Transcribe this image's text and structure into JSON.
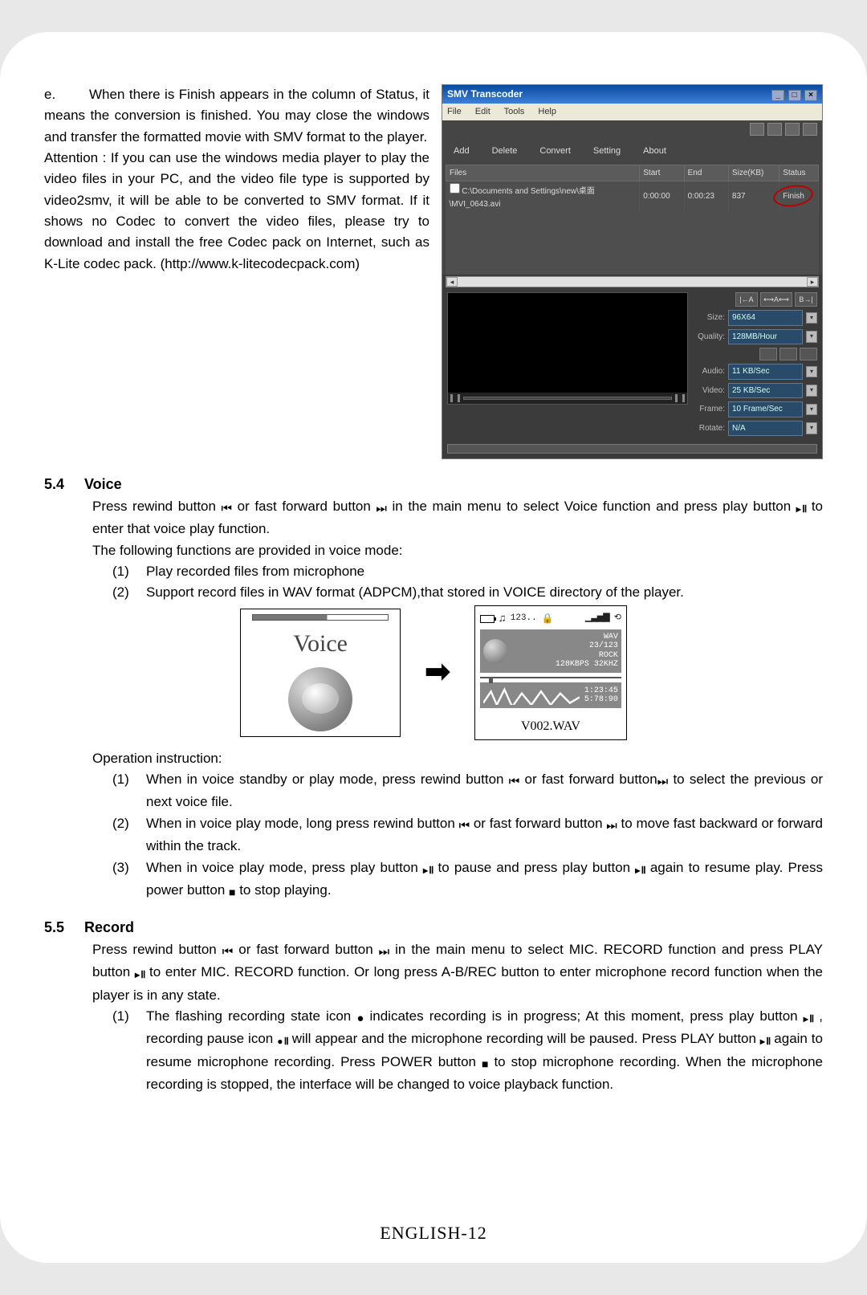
{
  "page_number": "ENGLISH-12",
  "intro": {
    "e_letter": "e.",
    "e_text": "When there is Finish appears in the column of Status, it means the conversion is finished. You may close the windows and transfer the formatted movie with SMV format to the player.",
    "attention": "Attention : If you can use the windows media player to play the video files in your PC, and the video file type is supported by video2smv, it will be able to be converted to SMV format. If it shows no Codec to convert the video files, please try to download and install the free Codec pack on Internet, such as K-Lite codec pack. (http://www.k-litecodecpack.com)"
  },
  "transcoder": {
    "title": "SMV Transcoder",
    "menu": {
      "file": "File",
      "edit": "Edit",
      "tools": "Tools",
      "help": "Help"
    },
    "toolbar": {
      "add": "Add",
      "delete": "Delete",
      "convert": "Convert",
      "setting": "Setting",
      "about": "About"
    },
    "columns": {
      "files": "Files",
      "start": "Start",
      "end": "End",
      "size": "Size(KB)",
      "status": "Status"
    },
    "row": {
      "path": "C:\\Documents and Settings\\new\\桌面\\MVI_0643.avi",
      "start": "0:00:00",
      "end": "0:00:23",
      "size": "837",
      "status": "Finish"
    },
    "settings": {
      "size_label": "Size:",
      "size_value": "96X64",
      "quality_label": "Quality:",
      "quality_value": "128MB/Hour",
      "audio_label": "Audio:",
      "audio_value": "11 KB/Sec",
      "video_label": "Video:",
      "video_value": "25 KB/Sec",
      "frame_label": "Frame:",
      "frame_value": "10 Frame/Sec",
      "rotate_label": "Rotate:",
      "rotate_value": "N/A",
      "trim_a": "|←A",
      "trim_b": "B→|",
      "trim_x": "⟷A⟷"
    }
  },
  "sec54": {
    "num": "5.4",
    "title": "Voice",
    "p1a": "Press rewind button ",
    "p1b": " or fast forward button ",
    "p1c": " in the main menu to select Voice function and press play button  ",
    "p1d": "  to enter that voice play function.",
    "p2": "The following functions are provided in voice mode:",
    "item1_n": "(1)",
    "item1": "Play recorded files from microphone",
    "item2_n": "(2)",
    "item2": "Support record files in WAV format (ADPCM),that stored in VOICE directory of the player.",
    "fig": {
      "voice_label": "Voice",
      "wav": "WAV",
      "track_no": "23/123",
      "codec": "ROCK",
      "bitrate": "128KBPS  32KHZ",
      "elapsed": "1:23:45",
      "total": "5:78:90",
      "filename": "V002.WAV"
    },
    "opinst": "Operation instruction:",
    "op1_n": "(1)",
    "op1a": "When in voice standby or play mode, press rewind button ",
    "op1b": " or fast forward button",
    "op1c": " to select the previous or next voice file.",
    "op2_n": "(2)",
    "op2a": "When in voice play mode, long press rewind button ",
    "op2b": " or fast forward button ",
    "op2c": " to move fast backward or forward within the track.",
    "op3_n": "(3)",
    "op3a": "When in voice play mode, press play button  ",
    "op3b": "  to pause and press play button  ",
    "op3c": "  again to resume play. Press power button ",
    "op3d": " to stop playing."
  },
  "sec55": {
    "num": "5.5",
    "title": "Record",
    "p1a": "Press rewind button ",
    "p1b": " or fast forward button ",
    "p1c": " in the main menu to select MIC. RECORD function and press PLAY button ",
    "p1d": "  to enter MIC. RECORD function. Or long press A-B/REC button to enter microphone record function when the player is in any state.",
    "item1_n": "(1)",
    "i1a": "The flashing recording state icon ",
    "i1b": " indicates recording is in progress; At this moment, press play button  ",
    "i1c": " , recording pause icon ",
    "i1d": " will appear and the microphone recording will be paused. Press PLAY button  ",
    "i1e": " again to resume microphone recording. Press POWER button ",
    "i1f": " to stop microphone recording. When the microphone recording is stopped, the interface will be changed to voice playback function."
  }
}
